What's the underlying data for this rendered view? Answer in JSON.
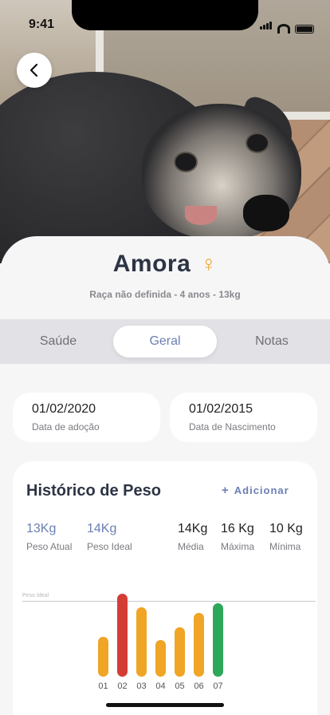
{
  "status_bar": {
    "time": "9:41"
  },
  "pet": {
    "name": "Amora",
    "gender_symbol": "♀",
    "subtitle": "Raça não definida - 4 anos - 13kg"
  },
  "tabs": [
    {
      "label": "Saúde",
      "active": false
    },
    {
      "label": "Geral",
      "active": true
    },
    {
      "label": "Notas",
      "active": false
    }
  ],
  "dates": [
    {
      "value": "01/02/2020",
      "label": "Data de adoção"
    },
    {
      "value": "01/02/2015",
      "label": "Data de Nascimento"
    }
  ],
  "weight_history": {
    "title": "Histórico de Peso",
    "add_label": "Adicionar",
    "stats": [
      {
        "value": "13Kg",
        "label": "Peso Atual"
      },
      {
        "value": "14Kg",
        "label": "Peso Ideal"
      },
      {
        "value": "14Kg",
        "label": "Média"
      },
      {
        "value": "16 Kg",
        "label": "Máxima"
      },
      {
        "value": "10 Kg",
        "label": "Mínima"
      }
    ],
    "ideal_line_label": "Peso Ideal"
  },
  "chart_data": {
    "type": "bar",
    "categories": [
      "01",
      "02",
      "03",
      "04",
      "05",
      "06",
      "07"
    ],
    "values": [
      0.48,
      1.0,
      0.84,
      0.44,
      0.6,
      0.77,
      0.88
    ],
    "ylim": [
      0,
      1
    ],
    "ideal_value": 0.91,
    "bar_colors": [
      "#f0a526",
      "#d43d35",
      "#f0a526",
      "#f0a526",
      "#f0a526",
      "#f0a526",
      "#2da85a"
    ]
  },
  "colors": {
    "accent": "#6b7fb2",
    "gender": "#f0a526",
    "text_dark": "#2d3444"
  }
}
